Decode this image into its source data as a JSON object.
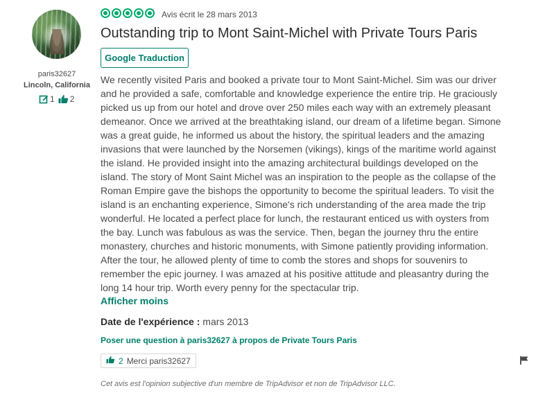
{
  "reviewer": {
    "username": "paris32627",
    "location": "Lincoln, California",
    "review_count": "1",
    "helpful_votes": "2"
  },
  "review": {
    "rating": 5,
    "date": "Avis écrit le 28 mars 2013",
    "title": "Outstanding trip to Mont Saint-Michel with Private Tours Paris",
    "translate_label": "Google Traduction",
    "body": "We recently visited Paris and booked a private tour to Mont Saint-Michel. Sim was our driver and he provided a safe, comfortable and knowledge experience the entire trip. He graciously picked us up from our hotel and drove over 250 miles each way with an extremely pleasant demeanor. Once we arrived at the breathtaking island, our dream of a lifetime began. Simone was a great guide, he informed us about the history, the spiritual leaders and the amazing invasions that were launched by the Norsemen (vikings), kings of the maritime world against the island. He provided insight into the amazing architectural buildings developed on the island. The story of Mont Saint Michel was an inspiration to the people as the collapse of the Roman Empire gave the bishops the opportunity to become the spiritual leaders. To visit the island is an enchanting experience, Simone's rich understanding of the area made the trip wonderful. He located a perfect place for lunch, the restaurant enticed us with oysters from the bay. Lunch was fabulous as was the service. Then, began the journey thru the entire monastery, churches and historic monuments, with Simone patiently providing information. After the tour, he allowed plenty of time to comb the stores and shops for souvenirs to remember the epic journey. I was amazed at his positive attitude and pleasantry during the long 14 hour trip. Worth every penny for the spectacular trip.",
    "show_less_label": "Afficher moins",
    "experience_label": "Date de l'expérience :",
    "experience_value": "mars 2013",
    "ask_question_label": "Poser une question à paris32627 à propos de Private Tours Paris",
    "thanks_count": "2",
    "thanks_label": "Merci paris32627",
    "disclaimer": "Cet avis est l'opinion subjective d'un membre de TripAdvisor et non de TripAdvisor LLC."
  },
  "colors": {
    "accent": "#00aa6c",
    "link": "#00806b",
    "text": "#4a4a4a"
  }
}
